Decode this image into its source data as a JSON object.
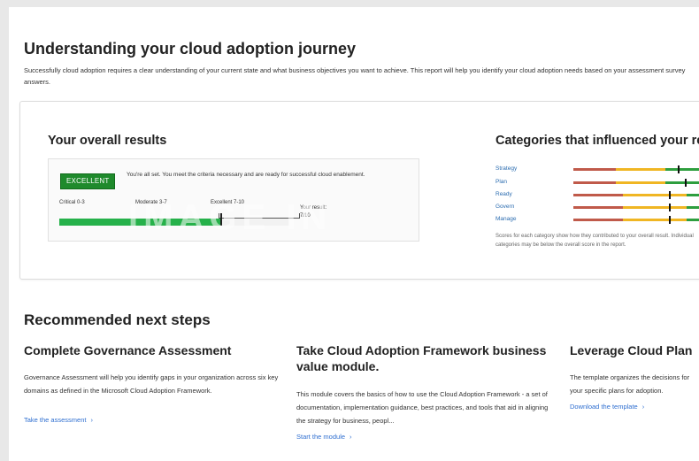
{
  "header": {
    "title": "Understanding your cloud adoption journey",
    "subtitle": "Successfully cloud adoption requires a clear understanding of your current state and what business objectives you want to achieve. This report will help you identify your cloud adoption needs based on your assessment survey answers."
  },
  "overall": {
    "heading": "Your overall results",
    "badge": "EXCELLENT",
    "message": "You're all set. You meet the criteria necessary and are ready for successful cloud enablement.",
    "scale": {
      "critical": "Critical 0-3",
      "moderate": "Moderate 3-7",
      "excellent": "Excellent 7-10"
    },
    "result_label": "Your result:",
    "result_value": "7/10",
    "result_fraction": 0.7,
    "watermark": "IMAGE IN",
    "colors": {
      "excellent": "#1f8a2c",
      "fill": "#26b14a"
    }
  },
  "categories": {
    "heading": "Categories that influenced your results",
    "items": [
      {
        "label": "Strategy"
      },
      {
        "label": "Plan"
      },
      {
        "label": "Ready"
      },
      {
        "label": "Govern"
      },
      {
        "label": "Manage"
      }
    ],
    "note": "Scores for each category show how they contributed to your overall result. Individual categories may be below the overall score in the report."
  },
  "next_steps": {
    "heading": "Recommended next steps",
    "cards": [
      {
        "title": "Complete Governance Assessment",
        "text": "Governance Assessment will help you identify gaps in your organization across six key domains as defined in the Microsoft Cloud Adoption Framework.",
        "link": "Take the assessment"
      },
      {
        "title": "Take Cloud Adoption Framework business value module.",
        "text": "This module covers the basics of how to use the Cloud Adoption Framework - a set of documentation, implementation guidance, best practices, and tools that aid in aligning the strategy for business, peopl...",
        "link": "Start the module"
      },
      {
        "title": "Leverage Cloud Plan",
        "text": "The template organizes the decisions for your specific plans for adoption.",
        "link": "Download the template"
      }
    ]
  }
}
